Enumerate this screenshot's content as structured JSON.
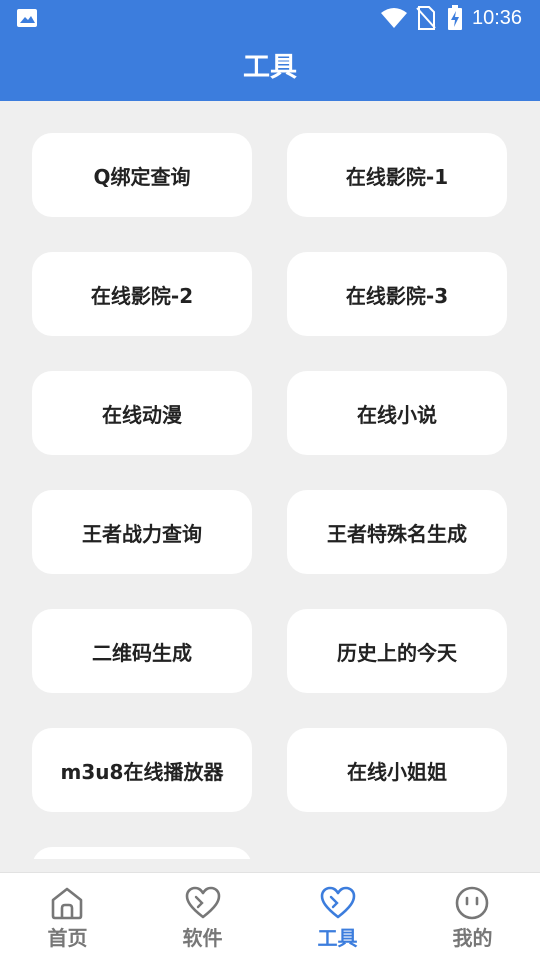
{
  "status_bar": {
    "time": "10:36"
  },
  "header": {
    "title": "工具"
  },
  "tools": [
    "Q绑定查询",
    "在线影院-1",
    "在线影院-2",
    "在线影院-3",
    "在线动漫",
    "在线小说",
    "王者战力查询",
    "王者特殊名生成",
    "二维码生成",
    "历史上的今天",
    "m3u8在线播放器",
    "在线小姐姐"
  ],
  "nav": [
    {
      "label": "首页",
      "icon": "home-icon",
      "active": false
    },
    {
      "label": "软件",
      "icon": "heart-icon",
      "active": false
    },
    {
      "label": "工具",
      "icon": "heart-icon",
      "active": true
    },
    {
      "label": "我的",
      "icon": "face-icon",
      "active": false
    }
  ],
  "colors": {
    "accent": "#3c7ddd",
    "background": "#efefef",
    "tile": "#ffffff",
    "nav_inactive": "#777777"
  }
}
